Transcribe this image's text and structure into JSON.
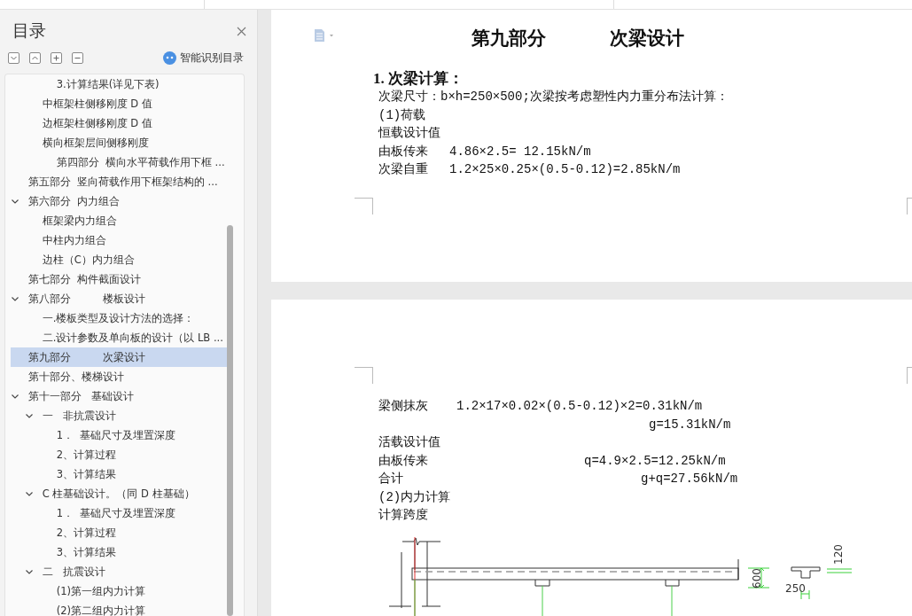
{
  "toc": {
    "title": "目录",
    "smart_button": "智能识别目录",
    "items": [
      {
        "children": [
          {
            "children": [
              {
                "label": "3.计算结果(详见下表)",
                "selected": false
              }
            ]
          },
          {
            "label": "中框架柱侧移刚度 D 值",
            "selected": false
          },
          {
            "label": "边框架柱侧移刚度 D 值",
            "selected": false
          },
          {
            "label": "横向框架层间侧移刚度",
            "selected": false
          },
          {
            "children": [
              {
                "label": "第四部分  横向水平荷载作用下框 ...",
                "selected": false
              }
            ]
          }
        ]
      },
      {
        "label": "第五部分  竖向荷载作用下框架结构的 ...",
        "selected": false
      },
      {
        "label": "第六部分  内力组合",
        "selected": false,
        "expanded": true,
        "children": [
          {
            "label": "框架梁内力组合",
            "selected": false
          },
          {
            "label": "中柱内力组合",
            "selected": false
          },
          {
            "label": "边柱（C）内力组合",
            "selected": false
          }
        ]
      },
      {
        "label": "第七部分  构件截面设计",
        "selected": false
      },
      {
        "label": "第八部分          楼板设计",
        "selected": false,
        "expanded": true,
        "children": [
          {
            "label": "一.楼板类型及设计方法的选择：",
            "selected": false
          },
          {
            "label": "二.设计参数及单向板的设计（以 LB ...",
            "selected": false
          }
        ]
      },
      {
        "label": "第九部分          次梁设计",
        "selected": true
      },
      {
        "label": "第十部分、楼梯设计",
        "selected": false
      },
      {
        "label": "第十一部分   基础设计",
        "selected": false,
        "expanded": true,
        "children": [
          {
            "label": "一   非抗震设计",
            "selected": false,
            "expanded": true,
            "children": [
              {
                "label": "1．  基础尺寸及埋置深度",
                "selected": false
              },
              {
                "label": "2、计算过程",
                "selected": false
              },
              {
                "label": "3、计算结果",
                "selected": false
              }
            ]
          },
          {
            "label": "C 柱基础设计。（同 D 柱基础）",
            "selected": false,
            "expanded": true,
            "children": [
              {
                "label": "1．  基础尺寸及埋置深度",
                "selected": false
              },
              {
                "label": "2、计算过程",
                "selected": false
              },
              {
                "label": "3、计算结果",
                "selected": false
              }
            ]
          },
          {
            "label": "二   抗震设计",
            "selected": false,
            "expanded": true,
            "children": [
              {
                "label": "(1)第一组内力计算",
                "selected": false
              },
              {
                "label": "(2)第二组内力计算",
                "selected": false
              }
            ]
          }
        ]
      }
    ]
  },
  "document": {
    "page_1": {
      "title_left": "第九部分",
      "title_right": "次梁设计",
      "heading": "1. 次梁计算：",
      "lines": [
        {
          "label": "次梁尺寸：b×h=250×500;次梁按考虑塑性内力重分布法计算："
        },
        {
          "label": "(1)荷载"
        },
        {
          "label": "恒载设计值"
        },
        {
          "label": "由板传来",
          "value": "4.86×2.5= 12.15kN/m"
        },
        {
          "label": "次梁自重",
          "value": "1.2×25×0.25×(0.5-0.12)=2.85kN/m"
        }
      ]
    },
    "page_2": {
      "lines": [
        {
          "label": "梁侧抹灰",
          "value": "1.2×17×0.02×(0.5-0.12)×2=0.31kN/m"
        },
        {
          "value": "g=15.31kN/m"
        },
        {
          "label": "活载设计值"
        },
        {
          "label": "由板传来",
          "value": "q=4.9×2.5=12.25kN/m"
        },
        {
          "label": "合计",
          "value": "g+q=27.56kN/m"
        },
        {
          "label": "(2)内力计算"
        },
        {
          "label": "计算跨度"
        }
      ],
      "drawing_labels": [
        "600",
        "250",
        "120"
      ]
    }
  }
}
